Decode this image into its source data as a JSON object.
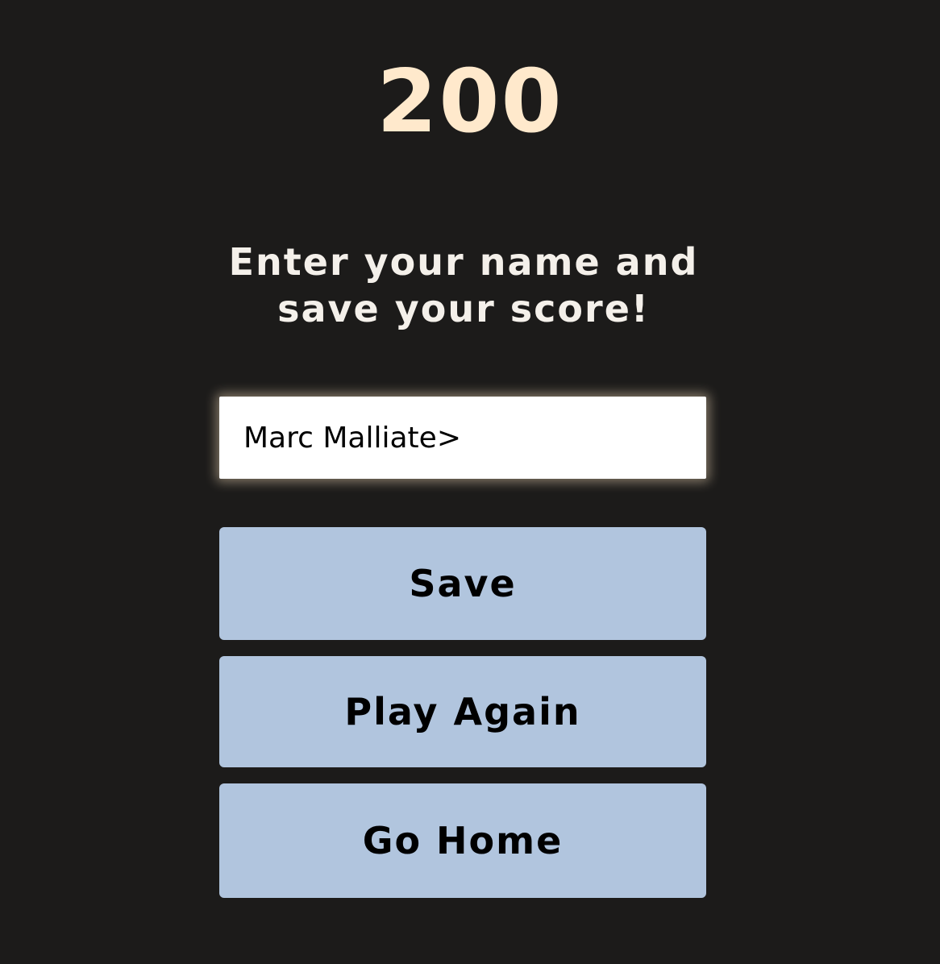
{
  "score": {
    "value": "200"
  },
  "prompt": {
    "text": "Enter your name and save your score!"
  },
  "name_input": {
    "value": "Marc Malliate>"
  },
  "buttons": {
    "save_label": "Save",
    "play_again_label": "Play Again",
    "go_home_label": "Go Home"
  },
  "colors": {
    "background": "#1c1b1a",
    "score": "#ffe9cc",
    "button": "#b1c5de",
    "input_glow": "#ffe6c3"
  }
}
